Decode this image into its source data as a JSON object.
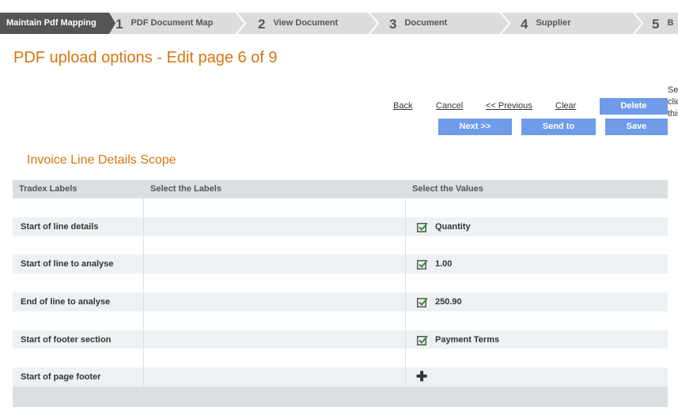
{
  "wizard": {
    "current": "Maintain Pdf Mapping",
    "steps": [
      {
        "num": "1",
        "label": "PDF Document Map"
      },
      {
        "num": "2",
        "label": "View Document"
      },
      {
        "num": "3",
        "label": "Document"
      },
      {
        "num": "4",
        "label": "Supplier"
      },
      {
        "num": "5",
        "label": "B"
      }
    ]
  },
  "page_title": "PDF upload options - Edit page 6 of 9",
  "help_text": [
    "Se",
    "clic",
    "this"
  ],
  "actions": {
    "back": "Back",
    "cancel": "Cancel",
    "previous": "<< Previous",
    "clear": "Clear",
    "delete": "Delete",
    "next": "Next >>",
    "send_to": "Send to",
    "save": "Save"
  },
  "section_title": "Invoice Line Details Scope",
  "table": {
    "headers": [
      "Tradex Labels",
      "Select the Labels",
      "Select the Values"
    ],
    "rows": [
      {
        "label": "",
        "value": "",
        "mark": "none"
      },
      {
        "label": "Start of line details",
        "value": "Quantity",
        "mark": "check"
      },
      {
        "label": "",
        "value": "",
        "mark": "none"
      },
      {
        "label": "Start of line to analyse",
        "value": "1.00",
        "mark": "check"
      },
      {
        "label": "",
        "value": "",
        "mark": "none"
      },
      {
        "label": "End of line to analyse",
        "value": "250.90",
        "mark": "check"
      },
      {
        "label": "",
        "value": "",
        "mark": "none"
      },
      {
        "label": "Start of footer section",
        "value": "Payment Terms",
        "mark": "check"
      },
      {
        "label": "",
        "value": "",
        "mark": "none"
      },
      {
        "label": "Start of page footer",
        "value": "",
        "mark": "plus"
      }
    ]
  },
  "colors": {
    "accent_orange": "#d9750f",
    "button_blue": "#6f9be9",
    "check_green": "#3a8a3a",
    "current_step": "#555555"
  }
}
